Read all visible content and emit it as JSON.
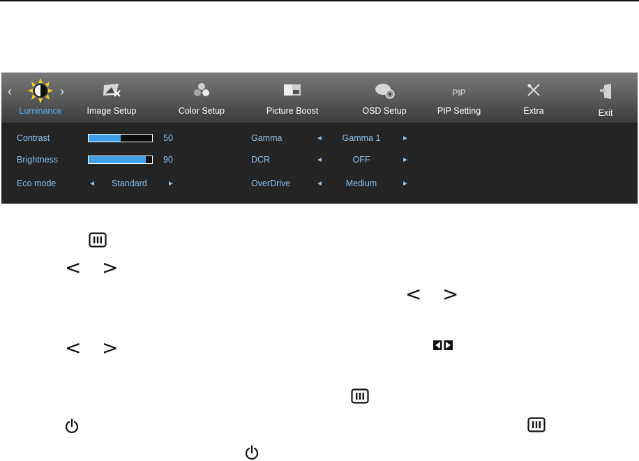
{
  "osd": {
    "tabs": [
      {
        "label": "Luminance",
        "icon": "sun-icon",
        "active": true
      },
      {
        "label": "Image Setup",
        "icon": "image-setup-icon",
        "active": false
      },
      {
        "label": "Color Setup",
        "icon": "color-dots-icon",
        "active": false
      },
      {
        "label": "Picture Boost",
        "icon": "picture-boost-icon",
        "active": false
      },
      {
        "label": "OSD Setup",
        "icon": "osd-setup-icon",
        "active": false
      },
      {
        "label": "PIP Setting",
        "icon": "pip-icon",
        "icon_text": "PIP",
        "active": false
      },
      {
        "label": "Extra",
        "icon": "extra-tools-icon",
        "active": false
      },
      {
        "label": "Exit",
        "icon": "exit-door-icon",
        "active": false
      }
    ],
    "left_column": {
      "contrast": {
        "label": "Contrast",
        "value": "50",
        "level": 0.5
      },
      "brightness": {
        "label": "Brightness",
        "value": "90",
        "level": 0.9
      },
      "eco_mode": {
        "label": "Eco mode",
        "value": "Standard"
      }
    },
    "right_column": {
      "gamma": {
        "label": "Gamma",
        "value": "Gamma 1"
      },
      "dcr": {
        "label": "DCR",
        "value": "OFF"
      },
      "overdrive": {
        "label": "OverDrive",
        "value": "Medium"
      }
    },
    "colors": {
      "active_tab": "#5aa9e6",
      "text": "#8fc0ec",
      "bar_fill": "#3ea0ea"
    }
  },
  "nav_glyphs": {
    "left": "<",
    "right": ">",
    "small_left": "◄",
    "small_right": "►"
  }
}
